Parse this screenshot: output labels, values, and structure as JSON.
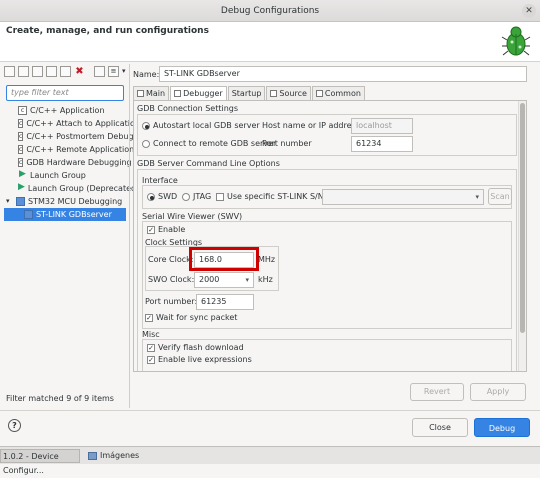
{
  "window": {
    "title": "Debug Configurations"
  },
  "header": {
    "text": "Create, manage, and run configurations"
  },
  "filter": {
    "placeholder": "type filter text"
  },
  "tree": [
    {
      "label": "C/C++ Application",
      "kind": "c"
    },
    {
      "label": "C/C++ Attach to Application",
      "kind": "c"
    },
    {
      "label": "C/C++ Postmortem Debugger",
      "kind": "c"
    },
    {
      "label": "C/C++ Remote Application",
      "kind": "c"
    },
    {
      "label": "GDB Hardware Debugging",
      "kind": "c"
    },
    {
      "label": "Launch Group",
      "kind": "launch"
    },
    {
      "label": "Launch Group (Deprecated)",
      "kind": "launch"
    },
    {
      "label": "STM32 MCU Debugging",
      "kind": "stm"
    },
    {
      "label": "ST-LINK GDBserver",
      "kind": "stm-child",
      "selected": true
    }
  ],
  "left_status": "Filter matched 9 of 9 items",
  "name": {
    "label": "Name:",
    "value": "ST-LINK GDBserver"
  },
  "tabs": [
    "Main",
    "Debugger",
    "Startup",
    "Source",
    "Common"
  ],
  "gdb_connection": {
    "title": "GDB Connection Settings",
    "autostart": "Autostart local GDB server",
    "connect_remote": "Connect to remote GDB server",
    "host_label": "Host name or IP address",
    "host_value": "localhost",
    "port_label": "Port number",
    "port_value": "61234"
  },
  "gdb_server": {
    "title": "GDB Server Command Line Options",
    "interface_title": "Interface",
    "swd": "SWD",
    "jtag": "JTAG",
    "use_sn": "Use specific ST-LINK S/N",
    "scan": "Scan"
  },
  "swv": {
    "title": "Serial Wire Viewer (SWV)",
    "enable": "Enable",
    "clock_title": "Clock Settings",
    "core_clock_label": "Core Clock:",
    "core_clock_value": "168.0",
    "core_clock_unit": "MHz",
    "swo_clock_label": "SWO Clock:",
    "swo_clock_value": "2000",
    "swo_clock_unit": "kHz",
    "port_label": "Port number:",
    "port_value": "61235",
    "wait_sync": "Wait for sync packet"
  },
  "misc": {
    "title": "Misc",
    "verify_flash": "Verify flash download",
    "live_expr": "Enable live expressions"
  },
  "buttons": {
    "revert": "Revert",
    "apply": "Apply",
    "close": "Close",
    "debug": "Debug"
  },
  "help": "?",
  "taskbar": [
    {
      "label": "1.0.2 - Device Configur...",
      "active": true
    },
    {
      "label": "Imágenes",
      "active": false
    }
  ]
}
